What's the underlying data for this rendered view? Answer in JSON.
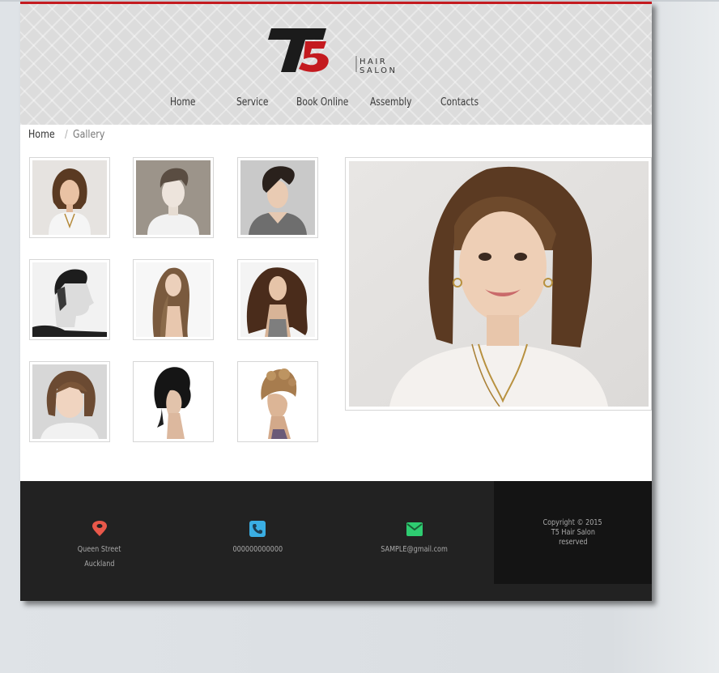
{
  "header": {
    "logo_text": "T5",
    "logo_sub_line1": "HAIR",
    "logo_sub_line2": "SALON",
    "accent_color": "#c41a1f"
  },
  "nav": {
    "items": [
      {
        "label": "Home"
      },
      {
        "label": "Service"
      },
      {
        "label": "Book Online"
      },
      {
        "label": "Assembly"
      },
      {
        "label": "Contacts"
      }
    ]
  },
  "breadcrumb": {
    "home": "Home",
    "separator": "/",
    "current": "Gallery"
  },
  "gallery": {
    "thumbnails": [
      {
        "icon": "woman-short-brown-hair-photo"
      },
      {
        "icon": "man-short-hair-photo"
      },
      {
        "icon": "man-styled-hair-photo"
      },
      {
        "icon": "man-side-profile-photo"
      },
      {
        "icon": "woman-long-straight-hair-photo"
      },
      {
        "icon": "woman-long-curly-hair-photo"
      },
      {
        "icon": "woman-bob-hair-photo"
      },
      {
        "icon": "woman-updo-black-hair-photo"
      },
      {
        "icon": "woman-braided-updo-photo"
      }
    ],
    "featured": {
      "icon": "featured-woman-portrait-photo"
    }
  },
  "footer": {
    "address_line1": "Queen Street",
    "address_line2": "Auckland",
    "phone": "000000000000",
    "email": "SAMPLE@gmail.com",
    "copyright_line1": "Copyright © 2015",
    "copyright_line2": "T5 Hair Salon",
    "copyright_line3": "reserved",
    "icon_colors": {
      "location": "#e9584a",
      "phone": "#3aaee3",
      "email": "#2ecc71"
    }
  }
}
